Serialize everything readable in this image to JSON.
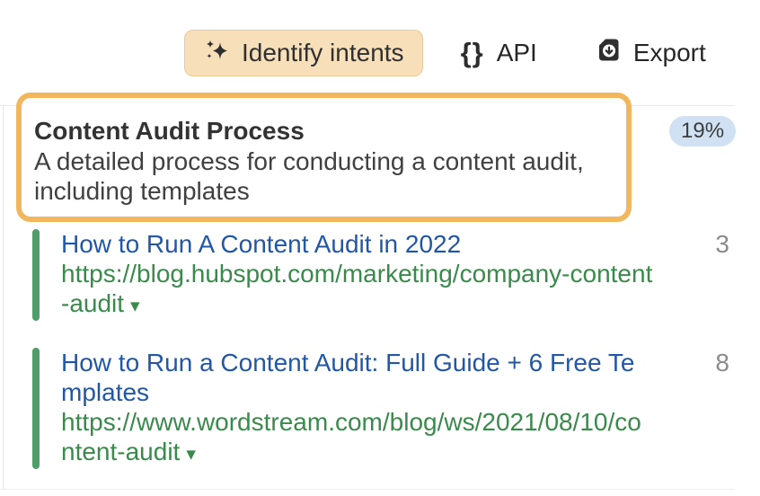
{
  "toolbar": {
    "identify_intents": {
      "label": "Identify intents"
    },
    "api": {
      "label": "API"
    },
    "export": {
      "label": "Export"
    }
  },
  "icons": {
    "curly_braces": "{}",
    "caret_down": "▾"
  },
  "intent_card": {
    "title": "Content Audit Process",
    "description": "A detailed process for conducting a content audit, including templates",
    "score": "19%"
  },
  "results": [
    {
      "title": "How to Run A Content Audit in 2022",
      "url": "https://blog.hubspot.com/marketing/company-content-audit",
      "count": "3"
    },
    {
      "title": "How to Run a Content Audit: Full Guide + 6 Free Templates",
      "url": "https://www.wordstream.com/blog/ws/2021/08/10/content-audit",
      "count": "8"
    }
  ],
  "colors": {
    "highlight_border": "#f2b65c",
    "button_background": "#f7dfba",
    "badge_background": "#cfe1f3",
    "link_blue": "#2257a5",
    "url_green": "#3a8a4c",
    "bar_green": "#4f9d68",
    "divider_gray": "#e9e9e9"
  }
}
